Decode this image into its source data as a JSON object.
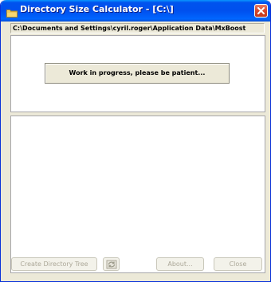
{
  "window": {
    "title": "Directory Size Calculator - [C:\\]",
    "icon": "folder-icon",
    "close_icon": "close-icon"
  },
  "path": {
    "value": "C:\\Documents and Settings\\cyril.roger\\Application Data\\MxBoost"
  },
  "status": {
    "message": "Work in progress, please be patient..."
  },
  "buttons": {
    "create_tree": "Create Directory Tree",
    "refresh_icon": "refresh-icon",
    "about": "About...",
    "close": "Close"
  },
  "colors": {
    "titlebar": "#0054e3",
    "window_face": "#ece9d8",
    "disabled_text": "#aca899",
    "close_button": "#d8482b"
  }
}
